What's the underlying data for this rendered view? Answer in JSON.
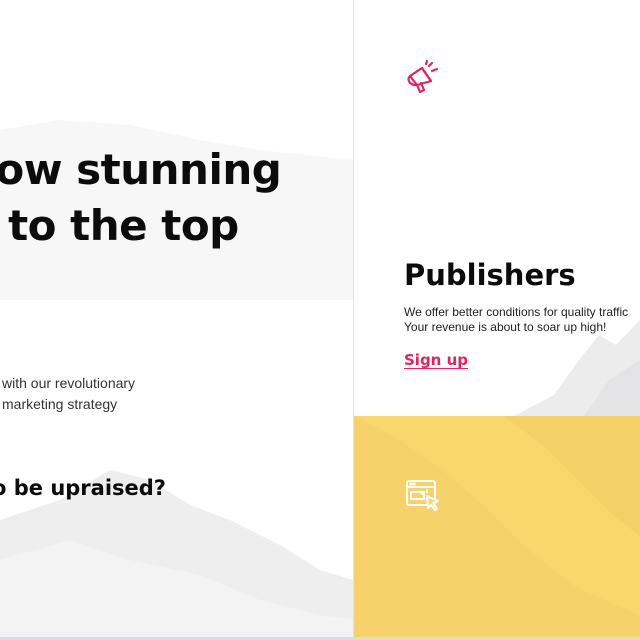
{
  "hero": {
    "title_line1": "how stunning",
    "title_line2": "e to the top",
    "subtitle_line1": "with our revolutionary",
    "subtitle_line2": "marketing strategy",
    "question": "o be upraised?"
  },
  "publishers_card": {
    "icon": "megaphone-icon",
    "title": "Publishers",
    "desc_line1": "We offer better conditions for quality traffic",
    "desc_line2": "Your revenue is about to soar up high!",
    "cta_label": "Sign up"
  },
  "advertisers_card": {
    "icon": "browser-click-icon"
  },
  "colors": {
    "accent": "#e0245e",
    "yellow_panel": "#f8d76b",
    "text": "#0c0c0c"
  }
}
